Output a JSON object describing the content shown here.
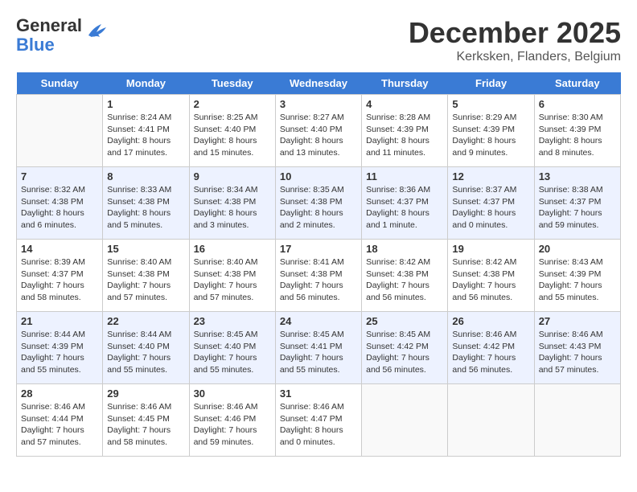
{
  "header": {
    "logo_general": "General",
    "logo_blue": "Blue",
    "title": "December 2025",
    "subtitle": "Kerksken, Flanders, Belgium"
  },
  "days_of_week": [
    "Sunday",
    "Monday",
    "Tuesday",
    "Wednesday",
    "Thursday",
    "Friday",
    "Saturday"
  ],
  "weeks": [
    [
      {
        "day": "",
        "sunrise": "",
        "sunset": "",
        "daylight": ""
      },
      {
        "day": "1",
        "sunrise": "Sunrise: 8:24 AM",
        "sunset": "Sunset: 4:41 PM",
        "daylight": "Daylight: 8 hours and 17 minutes."
      },
      {
        "day": "2",
        "sunrise": "Sunrise: 8:25 AM",
        "sunset": "Sunset: 4:40 PM",
        "daylight": "Daylight: 8 hours and 15 minutes."
      },
      {
        "day": "3",
        "sunrise": "Sunrise: 8:27 AM",
        "sunset": "Sunset: 4:40 PM",
        "daylight": "Daylight: 8 hours and 13 minutes."
      },
      {
        "day": "4",
        "sunrise": "Sunrise: 8:28 AM",
        "sunset": "Sunset: 4:39 PM",
        "daylight": "Daylight: 8 hours and 11 minutes."
      },
      {
        "day": "5",
        "sunrise": "Sunrise: 8:29 AM",
        "sunset": "Sunset: 4:39 PM",
        "daylight": "Daylight: 8 hours and 9 minutes."
      },
      {
        "day": "6",
        "sunrise": "Sunrise: 8:30 AM",
        "sunset": "Sunset: 4:39 PM",
        "daylight": "Daylight: 8 hours and 8 minutes."
      }
    ],
    [
      {
        "day": "7",
        "sunrise": "Sunrise: 8:32 AM",
        "sunset": "Sunset: 4:38 PM",
        "daylight": "Daylight: 8 hours and 6 minutes."
      },
      {
        "day": "8",
        "sunrise": "Sunrise: 8:33 AM",
        "sunset": "Sunset: 4:38 PM",
        "daylight": "Daylight: 8 hours and 5 minutes."
      },
      {
        "day": "9",
        "sunrise": "Sunrise: 8:34 AM",
        "sunset": "Sunset: 4:38 PM",
        "daylight": "Daylight: 8 hours and 3 minutes."
      },
      {
        "day": "10",
        "sunrise": "Sunrise: 8:35 AM",
        "sunset": "Sunset: 4:38 PM",
        "daylight": "Daylight: 8 hours and 2 minutes."
      },
      {
        "day": "11",
        "sunrise": "Sunrise: 8:36 AM",
        "sunset": "Sunset: 4:37 PM",
        "daylight": "Daylight: 8 hours and 1 minute."
      },
      {
        "day": "12",
        "sunrise": "Sunrise: 8:37 AM",
        "sunset": "Sunset: 4:37 PM",
        "daylight": "Daylight: 8 hours and 0 minutes."
      },
      {
        "day": "13",
        "sunrise": "Sunrise: 8:38 AM",
        "sunset": "Sunset: 4:37 PM",
        "daylight": "Daylight: 7 hours and 59 minutes."
      }
    ],
    [
      {
        "day": "14",
        "sunrise": "Sunrise: 8:39 AM",
        "sunset": "Sunset: 4:37 PM",
        "daylight": "Daylight: 7 hours and 58 minutes."
      },
      {
        "day": "15",
        "sunrise": "Sunrise: 8:40 AM",
        "sunset": "Sunset: 4:38 PM",
        "daylight": "Daylight: 7 hours and 57 minutes."
      },
      {
        "day": "16",
        "sunrise": "Sunrise: 8:40 AM",
        "sunset": "Sunset: 4:38 PM",
        "daylight": "Daylight: 7 hours and 57 minutes."
      },
      {
        "day": "17",
        "sunrise": "Sunrise: 8:41 AM",
        "sunset": "Sunset: 4:38 PM",
        "daylight": "Daylight: 7 hours and 56 minutes."
      },
      {
        "day": "18",
        "sunrise": "Sunrise: 8:42 AM",
        "sunset": "Sunset: 4:38 PM",
        "daylight": "Daylight: 7 hours and 56 minutes."
      },
      {
        "day": "19",
        "sunrise": "Sunrise: 8:42 AM",
        "sunset": "Sunset: 4:38 PM",
        "daylight": "Daylight: 7 hours and 56 minutes."
      },
      {
        "day": "20",
        "sunrise": "Sunrise: 8:43 AM",
        "sunset": "Sunset: 4:39 PM",
        "daylight": "Daylight: 7 hours and 55 minutes."
      }
    ],
    [
      {
        "day": "21",
        "sunrise": "Sunrise: 8:44 AM",
        "sunset": "Sunset: 4:39 PM",
        "daylight": "Daylight: 7 hours and 55 minutes."
      },
      {
        "day": "22",
        "sunrise": "Sunrise: 8:44 AM",
        "sunset": "Sunset: 4:40 PM",
        "daylight": "Daylight: 7 hours and 55 minutes."
      },
      {
        "day": "23",
        "sunrise": "Sunrise: 8:45 AM",
        "sunset": "Sunset: 4:40 PM",
        "daylight": "Daylight: 7 hours and 55 minutes."
      },
      {
        "day": "24",
        "sunrise": "Sunrise: 8:45 AM",
        "sunset": "Sunset: 4:41 PM",
        "daylight": "Daylight: 7 hours and 55 minutes."
      },
      {
        "day": "25",
        "sunrise": "Sunrise: 8:45 AM",
        "sunset": "Sunset: 4:42 PM",
        "daylight": "Daylight: 7 hours and 56 minutes."
      },
      {
        "day": "26",
        "sunrise": "Sunrise: 8:46 AM",
        "sunset": "Sunset: 4:42 PM",
        "daylight": "Daylight: 7 hours and 56 minutes."
      },
      {
        "day": "27",
        "sunrise": "Sunrise: 8:46 AM",
        "sunset": "Sunset: 4:43 PM",
        "daylight": "Daylight: 7 hours and 57 minutes."
      }
    ],
    [
      {
        "day": "28",
        "sunrise": "Sunrise: 8:46 AM",
        "sunset": "Sunset: 4:44 PM",
        "daylight": "Daylight: 7 hours and 57 minutes."
      },
      {
        "day": "29",
        "sunrise": "Sunrise: 8:46 AM",
        "sunset": "Sunset: 4:45 PM",
        "daylight": "Daylight: 7 hours and 58 minutes."
      },
      {
        "day": "30",
        "sunrise": "Sunrise: 8:46 AM",
        "sunset": "Sunset: 4:46 PM",
        "daylight": "Daylight: 7 hours and 59 minutes."
      },
      {
        "day": "31",
        "sunrise": "Sunrise: 8:46 AM",
        "sunset": "Sunset: 4:47 PM",
        "daylight": "Daylight: 8 hours and 0 minutes."
      },
      {
        "day": "",
        "sunrise": "",
        "sunset": "",
        "daylight": ""
      },
      {
        "day": "",
        "sunrise": "",
        "sunset": "",
        "daylight": ""
      },
      {
        "day": "",
        "sunrise": "",
        "sunset": "",
        "daylight": ""
      }
    ]
  ]
}
